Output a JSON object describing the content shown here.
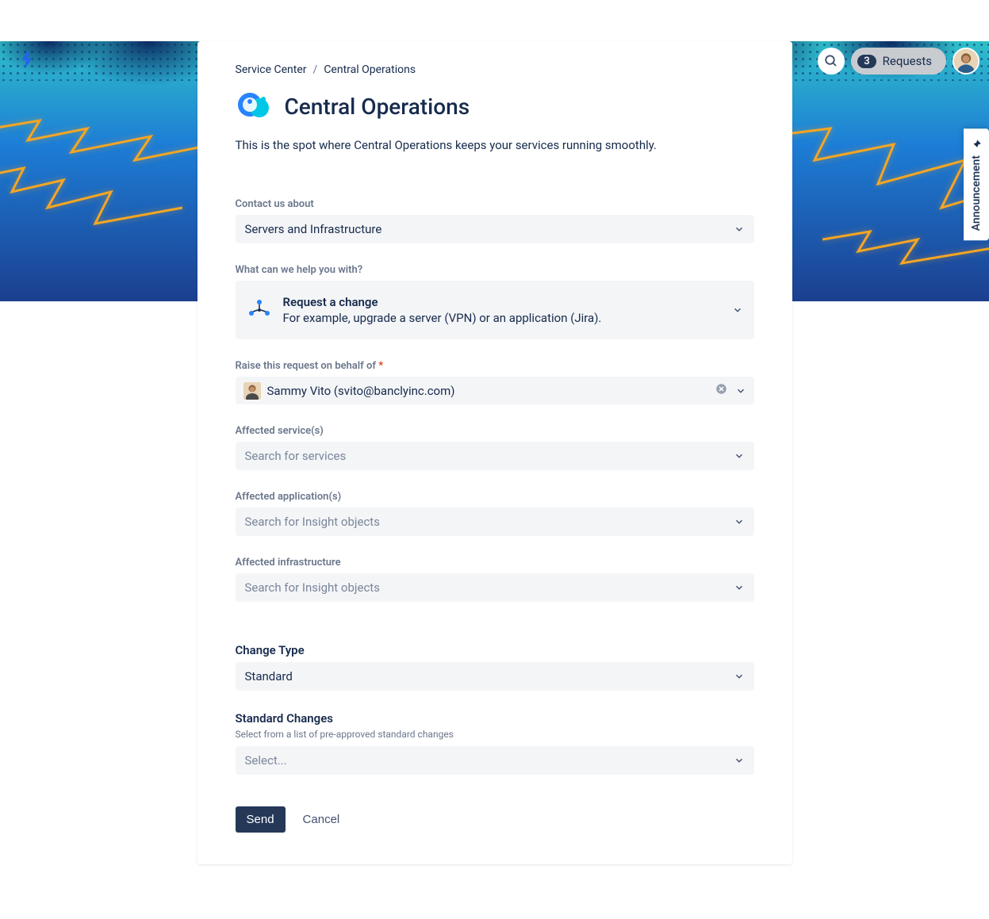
{
  "header": {
    "requests_count": "3",
    "requests_label": "Requests"
  },
  "breadcrumb": {
    "root": "Service Center",
    "current": "Central Operations"
  },
  "page_title": "Central Operations",
  "page_description": "This is the spot where Central Operations keeps your services running smoothly.",
  "form": {
    "contact_about": {
      "label": "Contact us about",
      "value": "Servers and Infrastructure"
    },
    "help_with": {
      "label": "What can we help you with?",
      "title": "Request a change",
      "description": "For example, upgrade a server (VPN) or an application (Jira)."
    },
    "on_behalf": {
      "label": "Raise this request on behalf of",
      "value": "Sammy Vito (svito@banclyinc.com)"
    },
    "affected_services": {
      "label": "Affected service(s)",
      "placeholder": "Search for services"
    },
    "affected_applications": {
      "label": "Affected application(s)",
      "placeholder": "Search for Insight objects"
    },
    "affected_infrastructure": {
      "label": "Affected infrastructure",
      "placeholder": "Search for Insight objects"
    },
    "change_type": {
      "label": "Change Type",
      "value": "Standard"
    },
    "standard_changes": {
      "label": "Standard Changes",
      "helper": "Select from a list of pre-approved standard changes",
      "placeholder": "Select..."
    }
  },
  "actions": {
    "submit": "Send",
    "cancel": "Cancel"
  },
  "sidebar": {
    "announcement": "Announcement"
  }
}
